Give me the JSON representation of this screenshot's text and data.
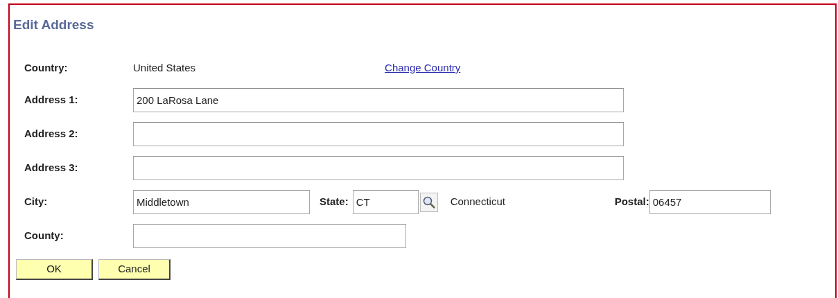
{
  "title": "Edit Address",
  "country": {
    "label": "Country:",
    "value": "United States",
    "link": "Change Country"
  },
  "address_lines": [
    {
      "label": "Address 1:",
      "value": "200 LaRosa Lane"
    },
    {
      "label": "Address 2:"
    },
    {
      "label": "Address 3:"
    }
  ],
  "city": {
    "label": "City:",
    "value": "Middletown"
  },
  "state": {
    "label": "State:",
    "value": "CT",
    "name": "Connecticut"
  },
  "postal": {
    "label": "Postal:",
    "value": "06457"
  },
  "county": {
    "label": "County:"
  },
  "buttons": [
    "OK",
    "Cancel"
  ]
}
